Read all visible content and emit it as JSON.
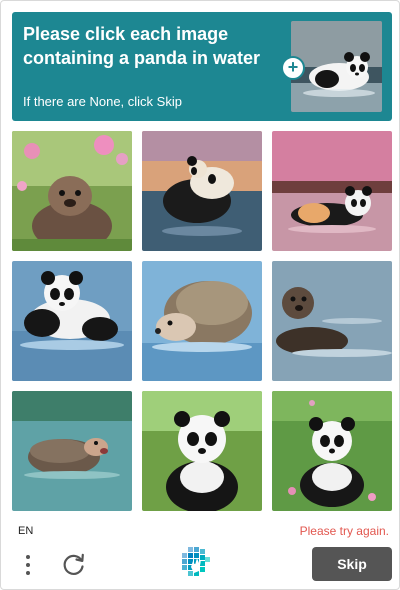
{
  "header": {
    "prompt": "Please click each image containing a panda in water",
    "instruction": "If there are None, click Skip",
    "example_image": "panda-in-water"
  },
  "grid": {
    "tiles": [
      {
        "subject": "otter on grass with pink flowers"
      },
      {
        "subject": "panda in water at sunset"
      },
      {
        "subject": "panda lying in pink-lit water"
      },
      {
        "subject": "panda swimming in water"
      },
      {
        "subject": "hedgehog in water"
      },
      {
        "subject": "otter swimming in water"
      },
      {
        "subject": "hedgehog in water"
      },
      {
        "subject": "panda sitting on grass"
      },
      {
        "subject": "panda sitting on grass with flowers"
      }
    ]
  },
  "footer": {
    "language": "EN",
    "error_message": "Please try again.",
    "menu_icon": "vertical-dots-icon",
    "refresh_icon": "refresh-icon",
    "logo_icon": "hcaptcha-logo-icon",
    "skip_label": "Skip"
  },
  "colors": {
    "header_bg": "#1d8792",
    "error_text": "#e2574f",
    "skip_bg": "#555555"
  }
}
